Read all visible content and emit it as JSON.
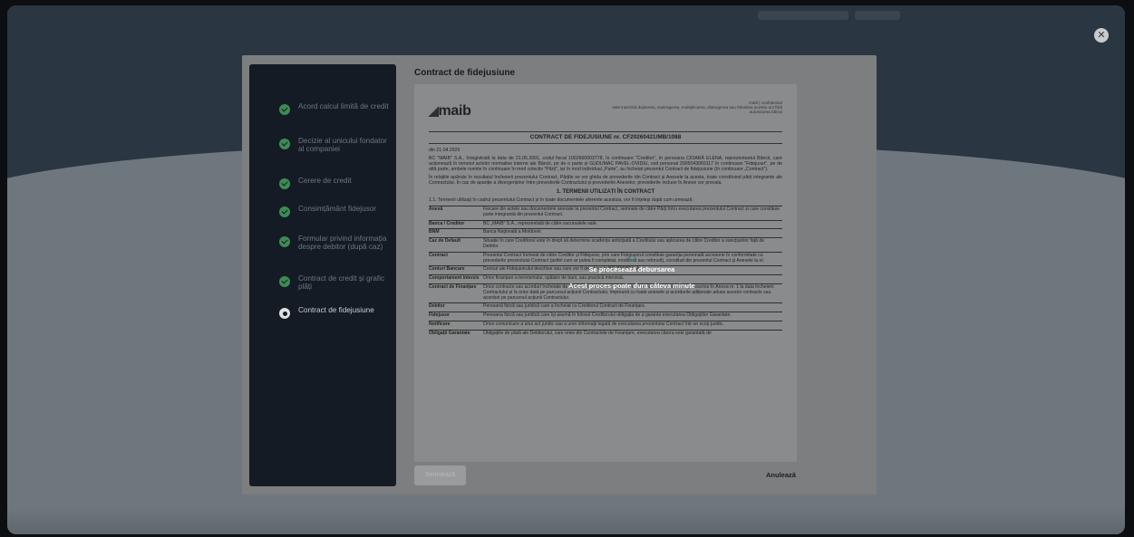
{
  "stepper": {
    "steps": [
      {
        "label": "Acord calcul limită de credit",
        "state": "done"
      },
      {
        "label": "Decizie al unicului fondator al companiei",
        "state": "done"
      },
      {
        "label": "Cerere de credit",
        "state": "done"
      },
      {
        "label": "Consimțământ fidejusor",
        "state": "done"
      },
      {
        "label": "Formular privind informația despre debitor (după caz)",
        "state": "done"
      },
      {
        "label": "Contract de credit și grafic plăți",
        "state": "done"
      },
      {
        "label": "Contract de fidejusiune",
        "state": "current"
      }
    ]
  },
  "content": {
    "title": "Contract de fidejusiune"
  },
  "document": {
    "logo_text": "maib",
    "confidential": "maib | confidential",
    "confidential_note": "este interzisă dejinerea, sustragerea, multiplicarea, distrugerea sau folosirea acestui act fără autorizarea băncii",
    "title": "CONTRACT DE FIDEJUSIUNE nr. CF20260421/MB/1088",
    "date": "din 21.04.2026",
    "intro": "BC \"MAIB\" S.A., înregistrată la data de 21.05.2001, codul fiscal 1002600003778, în continuare \"Creditor\", în persoana CIOARĂ ELENA, reprezentantul Băncii, care acționează în temeiul actelor normative interne ale Băncii, pe de o parte și GUDUMAC PAVEL-OVIDIU, cod personal 2005043069117 în continuare \"Fidejusor\", pe de altă parte, ambele numite în continuare în mod colectiv \"Părți\", iar în mod individual „Parte”, au încheiat prezentul Contract de fidejusiune (în continuare „Contract”).",
    "intro2": "În relațiile apărute în rezultatul încheierii prezentului Contract, Părțile se vor ghida de prevederile din Contract și Anexele la acesta, toate constituind părți integrante ale Contractului. În caz de apariție a divergențelor între prevederile Contractului și prevederile Anexelor, prevederile incluse în Anexe vor prevala.",
    "section1": "1. TERMENII UTILIZAȚI ÎN CONTRACT",
    "section1_intro": "1.1. Termenii utilizați în cadrul prezentului Contract și în toate documentele aferente acestuia, vor fi înțeleși după cum urmează:",
    "terms": [
      {
        "term": "Anexă",
        "def": "Fiecare din actele sau documentele anexate la prezentul Contract, semnate de către Părți întru executarea prezentului Contract și care constituie parte integrantă din prezentul Contract."
      },
      {
        "term": "Banca / Creditor",
        "def": "BC „MAIB” S.A., reprezentată de către sucursalele sale."
      },
      {
        "term": "BNM",
        "def": "Banca Națională a Moldovei."
      },
      {
        "term": "Caz de Default",
        "def": "Situație în care Creditorul este în drept să determine scadența anticipată a Creditului sau aplicarea de către Creditor a sancțiunilor față de Debitor."
      },
      {
        "term": "Contract",
        "def": "Prezentul Contract încheiat de către Creditor și Fidejusor, prin care Fidejusorul constituie garanția personală accesorie în conformitate cu prevederile prezentului Contract (astfel cum ar putea fi completat, modificat sau reînnoit), constituit din prezentul Contract și Anexele la el."
      },
      {
        "term": "Conturi Bancare",
        "def": "Conturi ale Fidejusorului deschise sau care vor fi deschise la BC \"MAIB\" S.A."
      },
      {
        "term": "Comportament interzis",
        "def": "Orice finanțare a terorismului, spălare de bani, sau practică interzisă."
      },
      {
        "term": "Contract de Finanțare",
        "def": "Orice contracte sau acorduri încheiate de Debitor cu Creditorul, după cum acestea vor fi enumerate și descrise în Anexa nr. 1 la data încheierii Contractului și la orice dată pe parcursul acțiunii Contractului, împreună cu toate anexele și acordurile adiționale aduse acestor contracte sau acorduri pe parcursul acțiunii Contractului."
      },
      {
        "term": "Debitor",
        "def": "Persoană fizică sau juridică care a încheiat cu Creditorul Contract de Finanțare."
      },
      {
        "term": "Fidejusor",
        "def": "Persoana fizică sau juridică care își asumă în folosul Creditorului obligația de a garanta executarea Obligațiilor Garantate."
      },
      {
        "term": "Notificare",
        "def": "Orice comunicare a unui act juridic sau a unei informații legată de executarea prezentului Contract într-un scop juridic."
      },
      {
        "term": "Obligații Garantate",
        "def": "Obligațiile de plată ale Debitorului, care reies din Contractele de Finanțare, executarea cărora este garantată de"
      }
    ]
  },
  "processing": {
    "title": "Se procesează debursarea",
    "subtitle": "Acest proces poate dura câteva minute"
  },
  "actions": {
    "sign_label": "Semnează",
    "cancel_label": "Anulează"
  },
  "colors": {
    "step_done": "#3d8a55",
    "stepper_bg": "#141b24",
    "overlay_bg": "#6f777e"
  }
}
